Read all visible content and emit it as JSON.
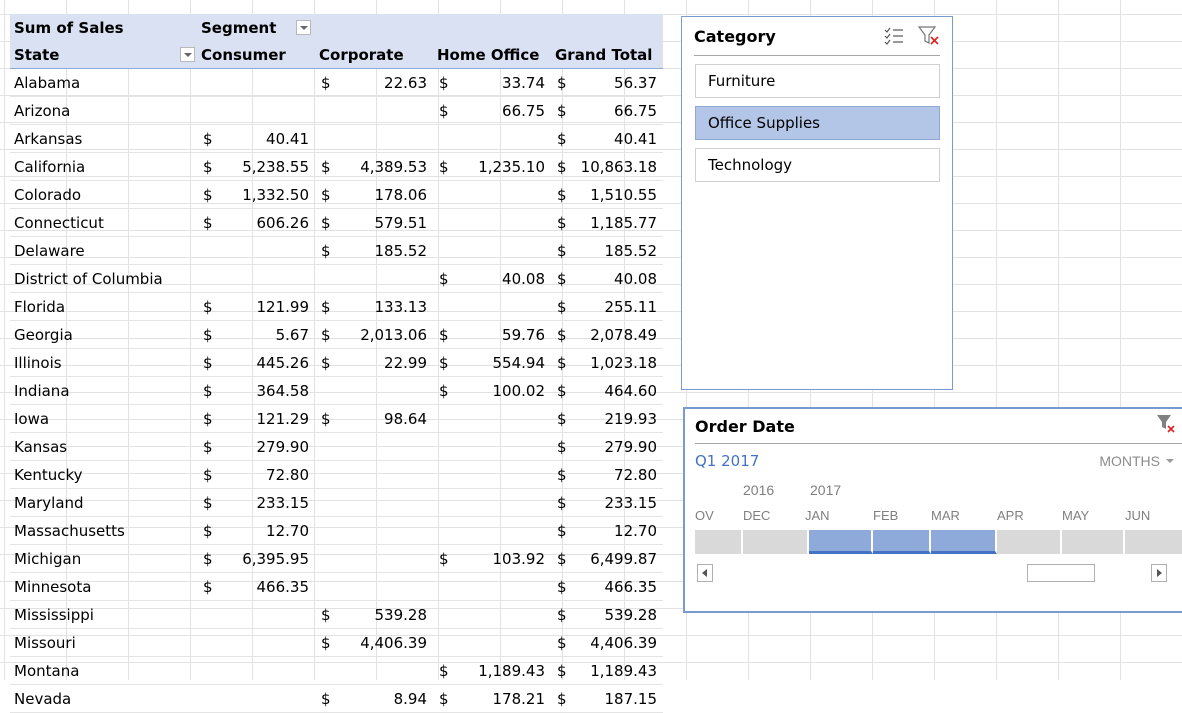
{
  "pivot": {
    "header1": {
      "values_label": "Sum of Sales",
      "column_field": "Segment"
    },
    "header2": {
      "row_field": "State",
      "columns": [
        "Consumer",
        "Corporate",
        "Home Office",
        "Grand Total"
      ]
    },
    "rows": [
      {
        "state": "Alabama",
        "values": [
          "",
          "22.63",
          "33.74",
          "56.37"
        ]
      },
      {
        "state": "Arizona",
        "values": [
          "",
          "",
          "66.75",
          "66.75"
        ]
      },
      {
        "state": "Arkansas",
        "values": [
          "40.41",
          "",
          "",
          "40.41"
        ]
      },
      {
        "state": "California",
        "values": [
          "5,238.55",
          "4,389.53",
          "1,235.10",
          "10,863.18"
        ]
      },
      {
        "state": "Colorado",
        "values": [
          "1,332.50",
          "178.06",
          "",
          "1,510.55"
        ]
      },
      {
        "state": "Connecticut",
        "values": [
          "606.26",
          "579.51",
          "",
          "1,185.77"
        ]
      },
      {
        "state": "Delaware",
        "values": [
          "",
          "185.52",
          "",
          "185.52"
        ]
      },
      {
        "state": "District of Columbia",
        "values": [
          "",
          "",
          "40.08",
          "40.08"
        ]
      },
      {
        "state": "Florida",
        "values": [
          "121.99",
          "133.13",
          "",
          "255.11"
        ]
      },
      {
        "state": "Georgia",
        "values": [
          "5.67",
          "2,013.06",
          "59.76",
          "2,078.49"
        ]
      },
      {
        "state": "Illinois",
        "values": [
          "445.26",
          "22.99",
          "554.94",
          "1,023.18"
        ]
      },
      {
        "state": "Indiana",
        "values": [
          "364.58",
          "",
          "100.02",
          "464.60"
        ]
      },
      {
        "state": "Iowa",
        "values": [
          "121.29",
          "98.64",
          "",
          "219.93"
        ]
      },
      {
        "state": "Kansas",
        "values": [
          "279.90",
          "",
          "",
          "279.90"
        ]
      },
      {
        "state": "Kentucky",
        "values": [
          "72.80",
          "",
          "",
          "72.80"
        ]
      },
      {
        "state": "Maryland",
        "values": [
          "233.15",
          "",
          "",
          "233.15"
        ]
      },
      {
        "state": "Massachusetts",
        "values": [
          "12.70",
          "",
          "",
          "12.70"
        ]
      },
      {
        "state": "Michigan",
        "values": [
          "6,395.95",
          "",
          "103.92",
          "6,499.87"
        ]
      },
      {
        "state": "Minnesota",
        "values": [
          "466.35",
          "",
          "",
          "466.35"
        ]
      },
      {
        "state": "Mississippi",
        "values": [
          "",
          "539.28",
          "",
          "539.28"
        ]
      },
      {
        "state": "Missouri",
        "values": [
          "",
          "4,406.39",
          "",
          "4,406.39"
        ]
      },
      {
        "state": "Montana",
        "values": [
          "",
          "",
          "1,189.43",
          "1,189.43"
        ]
      },
      {
        "state": "Nevada",
        "values": [
          "",
          "8.94",
          "178.21",
          "187.15"
        ]
      }
    ],
    "currency_symbol": "$"
  },
  "category_slicer": {
    "title": "Category",
    "icons": [
      "multi-select-icon",
      "clear-filter-icon"
    ],
    "items": [
      {
        "label": "Furniture",
        "selected": false
      },
      {
        "label": "Office Supplies",
        "selected": true
      },
      {
        "label": "Technology",
        "selected": false
      }
    ]
  },
  "timeline": {
    "title": "Order Date",
    "range_label": "Q1 2017",
    "level_label": "MONTHS",
    "years": [
      "2016",
      "2017"
    ],
    "months": [
      "OV",
      "DEC",
      "JAN",
      "FEB",
      "MAR",
      "APR",
      "MAY",
      "JUN"
    ],
    "selected_months": [
      "JAN",
      "FEB",
      "MAR"
    ]
  },
  "colors": {
    "header_fill": "#d9e1f2",
    "slicer_selected": "#b4c6e7",
    "timeline_selected": "#8eaadb",
    "accent": "#4472c4"
  }
}
